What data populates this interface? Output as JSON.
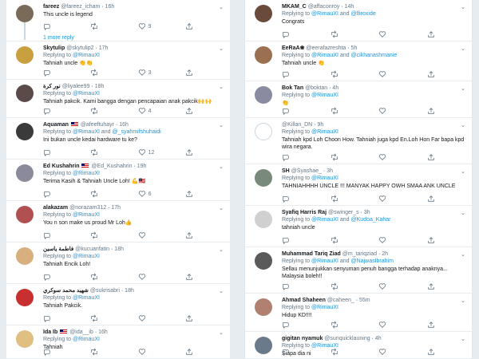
{
  "left": [
    {
      "name": "fareez",
      "handle": "@fareez_icham",
      "time": "16h",
      "flag": false,
      "replying": [],
      "text": "This uncle is legend",
      "counts": [
        "",
        "",
        "9",
        ""
      ],
      "more": "1 more reply",
      "av": "#7a6a5a"
    },
    {
      "name": "Skytulip",
      "handle": "@skytulip2",
      "time": "17h",
      "flag": false,
      "replying": [
        "@RimauXI"
      ],
      "text": "Tahniah uncle 👏👏",
      "counts": [
        "",
        "",
        "3",
        ""
      ],
      "av": "#c8a040"
    },
    {
      "name": "نور كرة",
      "handle": "@liyalee99",
      "time": "18h",
      "flag": false,
      "replying": [
        "@RimauXI"
      ],
      "text": "Tahniah pakcik. Kami bangga dengan pencapaian anak pakcik🙌🙌",
      "counts": [
        "",
        "",
        "4",
        ""
      ],
      "av": "#5a4a4a"
    },
    {
      "name": "Aquaman",
      "handle": "@afeeftuhayr",
      "time": "16h",
      "flag": true,
      "replying": [
        "@RimauXI",
        "@_syahmifshuhaidi"
      ],
      "text": "Ini bukan uncle kedai hardware tu ke?",
      "counts": [
        "",
        "",
        "12",
        ""
      ],
      "av": "#3a3a3a"
    },
    {
      "name": "Ed Kushahrin",
      "handle": "@Ed_Kushahrin",
      "time": "19h",
      "flag": true,
      "replying": [
        "@RimauXI"
      ],
      "text": "Terima Kasih & Tahniah Uncle Loh! 💪🇲🇾",
      "counts": [
        "",
        "",
        "6",
        ""
      ],
      "av": "#8a8a9a"
    },
    {
      "name": "alakazam",
      "handle": "@norazam312",
      "time": "17h",
      "flag": false,
      "replying": [
        "@RimauXI"
      ],
      "text": "You n son make us proud Mr Loh👍",
      "counts": [
        "",
        "",
        "",
        ""
      ],
      "av": "#b05050"
    },
    {
      "name": "فاطمة ياسين",
      "handle": "@kucuanfatin",
      "time": "18h",
      "flag": false,
      "replying": [
        "@RimauXI"
      ],
      "text": "Tahniah Encik Loh!",
      "counts": [
        "",
        "",
        "",
        ""
      ],
      "av": "#d8b080"
    },
    {
      "name": "شهيد محمد سوكري",
      "handle": "@sukrisabri",
      "time": "18h",
      "flag": false,
      "replying": [
        "@RimauXI"
      ],
      "text": "Tahniah Pakcik.",
      "counts": [
        "",
        "",
        "",
        ""
      ],
      "av": "#c83030"
    },
    {
      "name": "Ida Ib",
      "handle": "@ida__ib",
      "time": "16h",
      "flag": true,
      "replying": [
        "@RimauXI"
      ],
      "text": "Tahniah",
      "counts": [
        "",
        "",
        "",
        ""
      ],
      "av": "#e0c080"
    }
  ],
  "right": [
    {
      "name": "MKAM_C",
      "handle": "@affaconroy",
      "time": "14h",
      "flag": false,
      "replying": [
        "@RimauXI",
        "@fliroxide"
      ],
      "text": "Congrats",
      "counts": [
        "",
        "",
        "",
        ""
      ],
      "av": "#6a4a3a"
    },
    {
      "name": "EeRaA❀",
      "handle": "@eerafazreshta",
      "time": "5h",
      "flag": false,
      "replying": [
        "@RimauXI",
        "@cikhanashmanie"
      ],
      "text": "Tahniah uncle 👏",
      "counts": [
        "",
        "",
        "",
        ""
      ],
      "av": "#9a7050"
    },
    {
      "name": "Bok Tan",
      "handle": "@boktan",
      "time": "4h",
      "flag": false,
      "replying": [
        "@RimauXI"
      ],
      "text": "👏",
      "counts": [
        "",
        "",
        "",
        ""
      ],
      "av": "#8a8aa0"
    },
    {
      "name": "",
      "handle": "@Killan_DN",
      "time": "9h",
      "flag": false,
      "replying": [
        "@RimauXI"
      ],
      "text": "Tahniah kpd Loh Choon How. Tahniah juga kpd En.Loh Hon Far bapa kpd wira negara.",
      "counts": [
        "",
        "",
        "",
        ""
      ],
      "av": "#ffffff"
    },
    {
      "name": "SH",
      "handle": "@Syashae_",
      "time": "3h",
      "flag": false,
      "replying": [
        "@RimauXI"
      ],
      "text": "TAHNIAHHHH UNCLE !!! MANYAK HAPPY OWH SMAA ANK UNCLE",
      "counts": [
        "",
        "",
        "",
        ""
      ],
      "av": "#7a8a7a"
    },
    {
      "name": "Syafiq Harris Raj",
      "handle": "@swinger_s",
      "time": "3h",
      "flag": false,
      "replying": [
        "@RimauXI",
        "@Kudoa_Kahar"
      ],
      "text": "tahniah uncle",
      "counts": [
        "",
        "",
        "",
        ""
      ],
      "av": "#d0d0d0"
    },
    {
      "name": "Muhammad Tariq Ziad",
      "handle": "@m_tariqziad",
      "time": "2h",
      "flag": false,
      "replying": [
        "@RimauXI",
        "@NajwasIbrahim"
      ],
      "text": "Sellau menunjukkan senyuman penuh bangga terhadap anaknya... Malaysia boleh!!",
      "counts": [
        "",
        "",
        "",
        ""
      ],
      "av": "#5a5a5a"
    },
    {
      "name": "Ahmad Shaheen",
      "handle": "@caheen_",
      "time": "55m",
      "flag": false,
      "replying": [
        "@RimauXI"
      ],
      "text": "Hidup KD!!!!",
      "counts": [
        "",
        "",
        "",
        ""
      ],
      "av": "#b08070"
    },
    {
      "name": "gigitan nyamuk",
      "handle": "@sunquicklauning",
      "time": "4h",
      "flag": false,
      "replying": [
        "@RimauXI"
      ],
      "text": "Siapa dia ni",
      "counts": [
        "",
        "",
        "",
        ""
      ],
      "av": "#6a7a8a"
    }
  ],
  "replying_to_label": "Replying to",
  "and_label": "and",
  "colors": {
    "link": "#1b95e0",
    "muted": "#657786",
    "border": "#e6ecf0"
  }
}
